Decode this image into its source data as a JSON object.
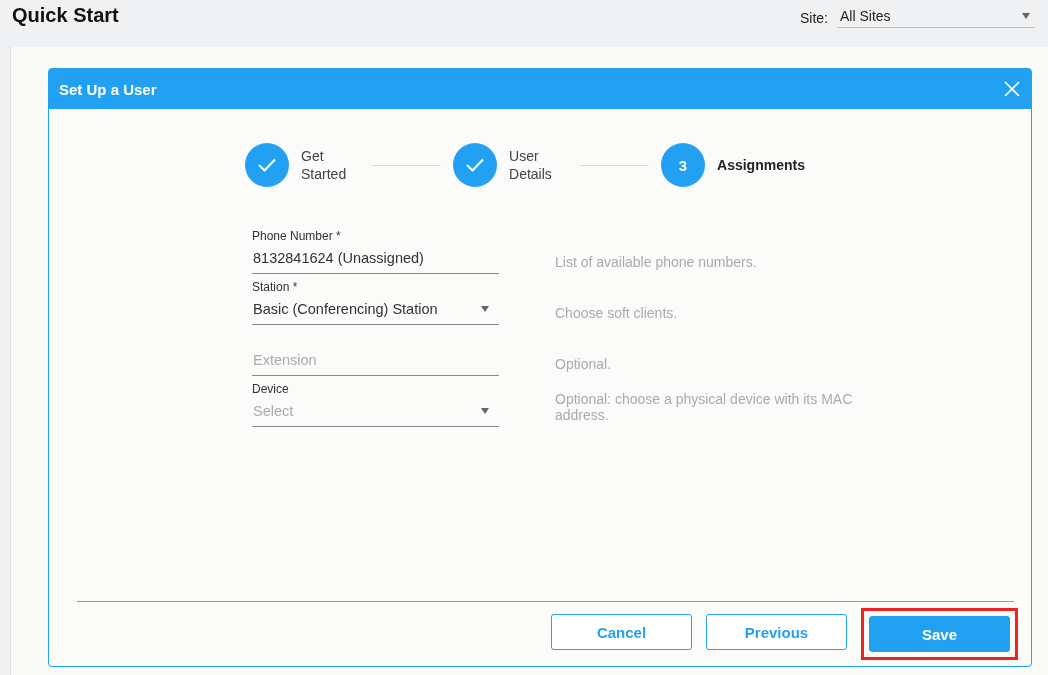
{
  "page": {
    "title": "Quick Start",
    "site_label": "Site:",
    "site_value": "All Sites"
  },
  "dialog": {
    "title": "Set Up a User",
    "steps": [
      {
        "label": "Get Started",
        "done": true,
        "selected": false
      },
      {
        "label": "User Details",
        "done": true,
        "selected": false
      },
      {
        "label": "Assignments",
        "number": "3",
        "done": false,
        "selected": true
      }
    ],
    "fields": [
      {
        "kind": "text",
        "label": "Phone Number *",
        "value": "8132841624 (Unassigned)",
        "hint": "List of available phone numbers."
      },
      {
        "kind": "select",
        "label": "Station *",
        "value": "Basic (Conferencing) Station",
        "hint": "Choose soft clients."
      },
      {
        "kind": "text",
        "placeholder": "Extension",
        "hint": "Optional."
      },
      {
        "kind": "select",
        "label": "Device",
        "placeholder": "Select",
        "hint": "Optional: choose a physical device with its MAC address."
      }
    ],
    "buttons": [
      {
        "label": "Cancel",
        "kind": "outline",
        "highlighted": false
      },
      {
        "label": "Previous",
        "kind": "outline",
        "highlighted": false
      },
      {
        "label": "Save",
        "kind": "primary",
        "highlighted": true
      }
    ]
  }
}
